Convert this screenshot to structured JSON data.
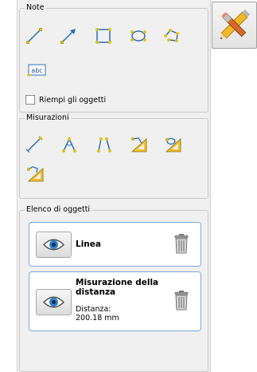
{
  "note": {
    "legend": "Note",
    "tools": [
      {
        "name": "line-tool",
        "icon": "line-icon"
      },
      {
        "name": "arrow-tool",
        "icon": "arrow-icon"
      },
      {
        "name": "rectangle-tool",
        "icon": "rectangle-icon"
      },
      {
        "name": "ellipse-tool",
        "icon": "ellipse-icon"
      },
      {
        "name": "polygon-tool",
        "icon": "polygon-icon"
      },
      {
        "name": "text-tool",
        "icon": "text-icon",
        "text": "abc"
      }
    ],
    "fill_objects_label": "Riempi gli oggetti",
    "fill_objects_checked": false
  },
  "measurements": {
    "legend": "Misurazioni",
    "tools": [
      {
        "name": "distance-measure-tool",
        "icon": "distance-icon"
      },
      {
        "name": "angle-measure-tool",
        "icon": "angle-icon"
      },
      {
        "name": "open-angle-measure-tool",
        "icon": "open-angle-icon"
      },
      {
        "name": "area-measure-tool-1",
        "icon": "area-ruler-icon"
      },
      {
        "name": "area-measure-tool-2",
        "icon": "area-ruler-icon"
      },
      {
        "name": "area-measure-tool-3",
        "icon": "area-ruler-icon"
      }
    ]
  },
  "objects": {
    "legend": "Elenco di oggetti",
    "items": [
      {
        "label": "Linea"
      },
      {
        "label": "Misurazione della distanza",
        "detail": "Distanza: 200.18 mm"
      }
    ]
  },
  "close_button": {
    "icon": "close-pencil-icon"
  }
}
